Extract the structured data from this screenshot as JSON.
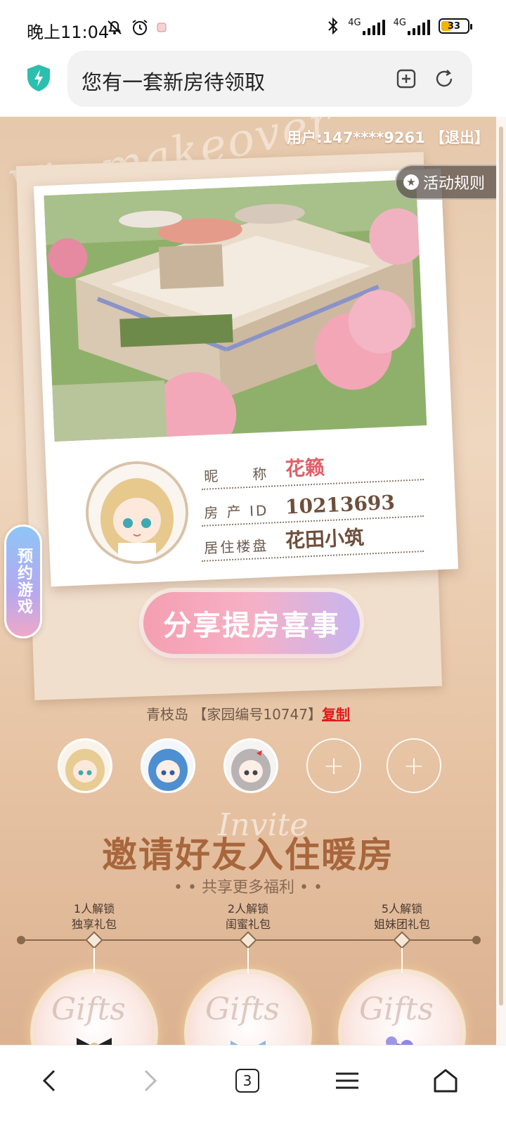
{
  "status_bar": {
    "time": "晚上11:04",
    "net1": "4G",
    "net2": "4G",
    "battery": "33",
    "icons": [
      "mute-bell-icon",
      "alarm-icon",
      "notification-app-icon",
      "bluetooth-icon",
      "signal-icon",
      "battery-icon"
    ]
  },
  "browser": {
    "page_title": "您有一套新房待领取",
    "icons": [
      "shield-icon",
      "bookmark-add-icon",
      "refresh-icon"
    ]
  },
  "page": {
    "user_line": "用户:147****9261 【退出】",
    "rules_label": "活动规则",
    "side_tab_label": "预约游戏",
    "profile": {
      "nickname_label": "昵　　称",
      "nickname_value": "花籁",
      "id_label": "房 产 ID",
      "id_value": "10213693",
      "estate_label": "居住楼盘",
      "estate_value": "花田小筑"
    },
    "share_button": "分享提房喜事",
    "home_prefix": "青枝岛 【家园编号10747】",
    "copy_link": "复制",
    "friend_add": "+",
    "invite_title": "邀请好友入住暖房",
    "invite_subtitle": "• •  共享更多福利  • •",
    "tiers": [
      {
        "line1": "1人解锁",
        "line2": "独享礼包"
      },
      {
        "line1": "2人解锁",
        "line2": "闺蜜礼包"
      },
      {
        "line1": "5人解锁",
        "line2": "姐妹团礼包"
      }
    ]
  },
  "bottom_nav": {
    "tab_count": "3",
    "icons": [
      "back-icon",
      "forward-icon",
      "tabs-icon",
      "menu-icon",
      "home-icon"
    ]
  },
  "colors": {
    "accent_pink": "#e0606a",
    "copy_red": "#e01a1a",
    "title_brown": "#a8663c",
    "shield_teal": "#2bbfb0"
  }
}
